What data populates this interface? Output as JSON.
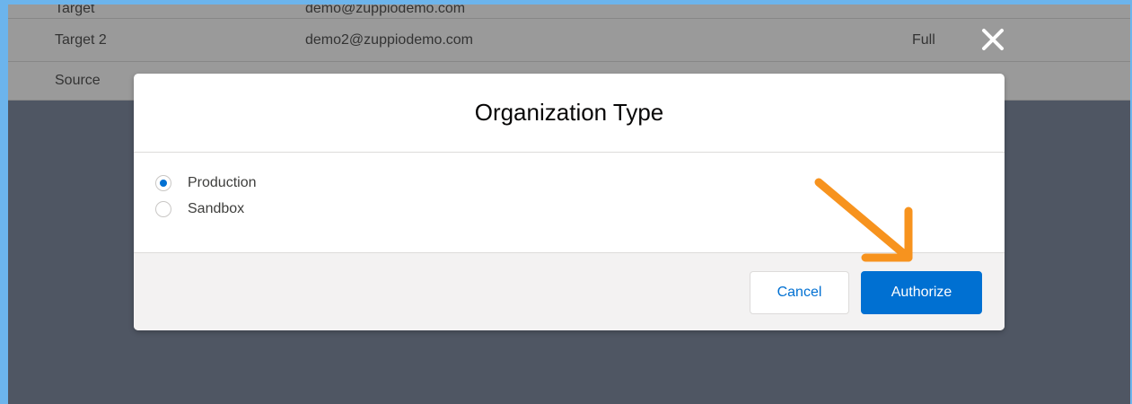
{
  "background_table": {
    "partial_row": {
      "col1": "Target",
      "col2": "demo@zuppiodemo.com"
    },
    "target2_row": {
      "label": "Target 2",
      "email": "demo2@zuppiodemo.com",
      "access": "Full",
      "remove_icon": "close-x-icon"
    },
    "source_row": {
      "label": "Source"
    }
  },
  "modal": {
    "title": "Organization Type",
    "options": [
      {
        "label": "Production",
        "selected": true
      },
      {
        "label": "Sandbox",
        "selected": false
      }
    ],
    "cancel_label": "Cancel",
    "authorize_label": "Authorize"
  },
  "annotation": {
    "arrow_color": "#f7931e",
    "arrow_icon": "arrow-down-right-icon"
  },
  "colors": {
    "brand_blue": "#0070d2",
    "frame_border": "#6cb4ec",
    "overlay": "#4f5663"
  }
}
